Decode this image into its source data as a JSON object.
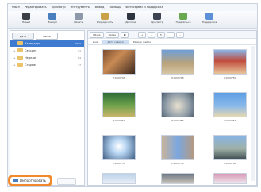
{
  "menu": [
    "Файл",
    "Редактировать",
    "Просмотр",
    "Инструменты",
    "Вывод",
    "Помощь",
    "Фотосервис и поддержка"
  ],
  "toolbar": [
    {
      "label": "Новый",
      "icon": "monitor-icon"
    },
    {
      "label": "Импорт",
      "icon": "import-icon"
    },
    {
      "label": "Печать",
      "icon": "print-icon"
    },
    {
      "label": "Упорядочить",
      "icon": "organize-icon"
    },
    {
      "label": "Дисплей",
      "icon": "display-icon"
    },
    {
      "label": "Просмотр",
      "icon": "view-icon"
    },
    {
      "label": "Поделиться",
      "icon": "share-icon"
    },
    {
      "label": "Поддержка",
      "icon": "support-icon"
    }
  ],
  "left_tabs": [
    "Дата",
    "Папки"
  ],
  "tree": [
    {
      "label": "Календарь",
      "count": "1840",
      "selected": true
    },
    {
      "label": "Сегодня",
      "count": "21",
      "selected": false
    },
    {
      "label": "Недели",
      "count": "64",
      "selected": false
    },
    {
      "label": "Старые",
      "count": "17",
      "selected": false
    }
  ],
  "import_button": "Импортировать",
  "secondary_button": "",
  "right_tabs": [
    "Обзор",
    "Экран"
  ],
  "right_header": [
    "Имя",
    "Дата съёмки",
    "Размер файла"
  ],
  "thumbnails": [
    {
      "label": "P1000745"
    },
    {
      "label": "P1000748"
    },
    {
      "label": "P1000750"
    },
    {
      "label": "P1000752"
    },
    {
      "label": "P1000753"
    },
    {
      "label": "P1000754"
    },
    {
      "label": "P1000757"
    },
    {
      "label": "P1000758"
    },
    {
      "label": "P1000760"
    },
    {
      "label": ""
    },
    {
      "label": ""
    },
    {
      "label": ""
    }
  ]
}
